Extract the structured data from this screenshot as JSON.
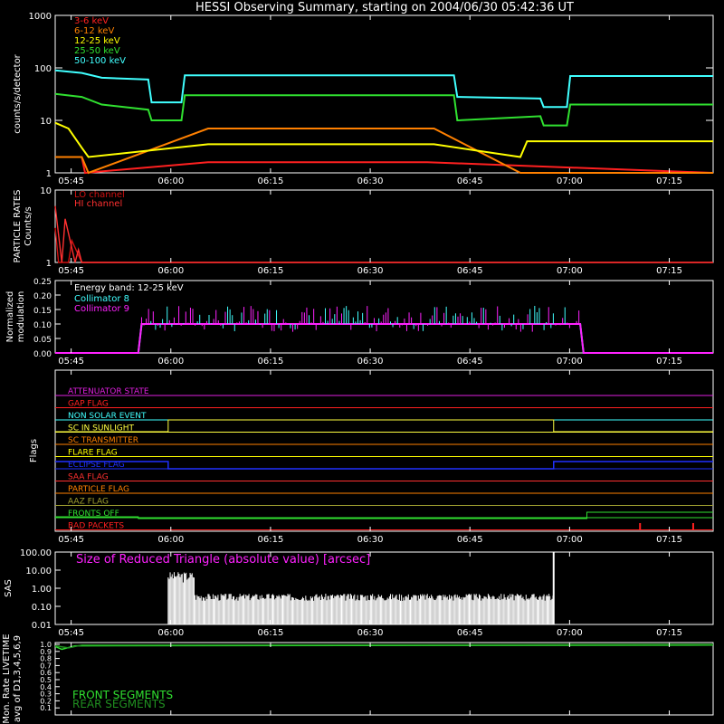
{
  "title": "HESSI Observing Summary, starting on 2004/06/30 05:42:36 UT",
  "time_ticks": [
    "05:45",
    "06:00",
    "06:15",
    "06:30",
    "06:45",
    "07:00",
    "07:15"
  ],
  "colors": {
    "background": "#000000",
    "axes": "#ffffff",
    "kev_3_6": "#ff2020",
    "kev_6_12": "#ff8000",
    "kev_12_25": "#ffff00",
    "kev_25_50": "#30e030",
    "kev_50_100": "#40ffff",
    "magenta": "#ff22ff",
    "lo_channel": "#d01010",
    "hi_channel": "#ff3030",
    "blue": "#2030ff"
  },
  "chart_data": [
    {
      "type": "line",
      "title": "HESSI Observing Summary, starting on 2004/06/30 05:42:36 UT",
      "ylabel": "counts/s/detector",
      "yscale": "log",
      "ylim": [
        1,
        1000
      ],
      "ytick_labels": [
        "1",
        "10",
        "100",
        "1000"
      ],
      "legend_placement": "top-left",
      "x_unit": "minutes after 05:42:36 UT",
      "series": [
        {
          "name": "3-6 keV",
          "color": "#ff2020",
          "x": [
            0,
            4,
            4.5,
            23,
            56,
            99
          ],
          "y": [
            2,
            2,
            1,
            1.6,
            1.6,
            1
          ]
        },
        {
          "name": "6-12 keV",
          "color": "#ff8000",
          "x": [
            0,
            4,
            5,
            23,
            57,
            70,
            99
          ],
          "y": [
            2,
            2,
            1,
            7,
            7,
            1,
            1
          ]
        },
        {
          "name": "12-25 keV",
          "color": "#ffff00",
          "x": [
            0,
            2,
            4,
            5,
            23,
            57,
            70,
            71,
            99
          ],
          "y": [
            9,
            7,
            3,
            2,
            3.5,
            3.5,
            2,
            4,
            4
          ]
        },
        {
          "name": "25-50 keV",
          "color": "#30e030",
          "x": [
            0,
            4,
            7,
            14,
            14.5,
            19,
            19.5,
            60,
            60.5,
            73,
            73.5,
            77,
            77.5,
            99
          ],
          "y": [
            32,
            28,
            20,
            16,
            10,
            10,
            30,
            30,
            10,
            12,
            8,
            8,
            20,
            20
          ]
        },
        {
          "name": "50-100 keV",
          "color": "#40ffff",
          "x": [
            0,
            4,
            7,
            14,
            14.5,
            19,
            19.5,
            60,
            60.5,
            73,
            73.5,
            77,
            77.5,
            99
          ],
          "y": [
            90,
            80,
            65,
            60,
            22,
            22,
            72,
            72,
            28,
            26,
            18,
            18,
            70,
            70
          ]
        }
      ]
    },
    {
      "type": "line",
      "ylabel": "PARTICLE RATES Counts/s",
      "yscale": "log",
      "ylim": [
        1,
        10
      ],
      "ytick_labels": [
        "1",
        "10"
      ],
      "series": [
        {
          "name": "LO channel",
          "color": "#d01010",
          "x": [
            0,
            0.5,
            2,
            2.5,
            4,
            99
          ],
          "y": [
            3,
            1,
            1,
            2,
            1,
            1
          ]
        },
        {
          "name": "HI channel",
          "color": "#ff3030",
          "x": [
            0,
            1,
            1.5,
            3,
            3.5,
            4,
            99
          ],
          "y": [
            6,
            1,
            4,
            1,
            1.5,
            1,
            1
          ]
        }
      ]
    },
    {
      "type": "line",
      "ylabel": "Normalized modulation",
      "ylim": [
        0,
        0.25
      ],
      "ytick_labels": [
        "0.00",
        "0.05",
        "0.10",
        "0.15",
        "0.20",
        "0.25"
      ],
      "annotation": "Energy band: 12-25 keV",
      "series": [
        {
          "name": "Collimator 8",
          "color": "#40ffff",
          "x": [
            0,
            12.5,
            13,
            79,
            79.5,
            99
          ],
          "y": [
            0,
            0,
            0.1,
            0.1,
            0,
            0
          ]
        },
        {
          "name": "Collimator 9",
          "color": "#ff22ff",
          "x": [
            0,
            12.5,
            13,
            79,
            79.5,
            99
          ],
          "y": [
            0,
            0,
            0.1,
            0.1,
            0,
            0
          ]
        }
      ]
    },
    {
      "type": "line",
      "ylabel": "Flags",
      "flags": [
        {
          "name": "ATTENUATOR STATE",
          "color": "#e020e0"
        },
        {
          "name": "GAP FLAG",
          "color": "#ff2020"
        },
        {
          "name": "NON SOLAR EVENT",
          "color": "#40ffff"
        },
        {
          "name": "SC IN SUNLIGHT",
          "color": "#ffff40"
        },
        {
          "name": "SC TRANSMITTER",
          "color": "#ff8000"
        },
        {
          "name": "FLARE FLAG",
          "color": "#ffff00"
        },
        {
          "name": "ECLIPSE FLAG",
          "color": "#2030ff"
        },
        {
          "name": "SAA FLAG",
          "color": "#ff3030"
        },
        {
          "name": "PARTICLE FLAG",
          "color": "#ff8000"
        },
        {
          "name": "AAZ FLAG",
          "color": "#a0a030"
        },
        {
          "name": "FRONTS OFF",
          "color": "#30e030"
        },
        {
          "name": "BAD PACKETS",
          "color": "#ff2020"
        }
      ]
    },
    {
      "type": "line",
      "ylabel": "SAS",
      "yscale": "log",
      "ylim": [
        0.01,
        100
      ],
      "ytick_labels": [
        "0.01",
        "0.10",
        "1.00",
        "10.00",
        "100.00"
      ],
      "annotation": "Size of Reduced Triangle (absolute value) [arcsec]",
      "series": [
        {
          "name": "",
          "color": "#ffffff",
          "x": [
            17,
            17.5,
            18,
            20,
            21,
            25,
            40,
            50,
            60,
            70,
            74.5,
            75
          ],
          "y": [
            0.01,
            8,
            2,
            6,
            0.3,
            0.2,
            0.15,
            0.3,
            0.4,
            0.4,
            0.5,
            100
          ]
        }
      ]
    },
    {
      "type": "line",
      "ylabel": "Mon. Rate LIVETIME avg of D1,3,4,5,6,9",
      "ylim": [
        0,
        1
      ],
      "ytick_labels": [
        "0.1",
        "0.2",
        "0.3",
        "0.4",
        "0.5",
        "0.6",
        "0.7",
        "0.8",
        "0.9",
        "1.0"
      ],
      "series": [
        {
          "name": "FRONT SEGMENTS",
          "color": "#30e030",
          "x": [
            0,
            1,
            3,
            99
          ],
          "y": [
            0.97,
            0.93,
            0.98,
            0.99
          ]
        },
        {
          "name": "REAR SEGMENTS",
          "color": "#209020",
          "x": [
            0,
            2,
            4,
            99
          ],
          "y": [
            0.98,
            0.95,
            0.99,
            1.0
          ]
        }
      ]
    }
  ]
}
